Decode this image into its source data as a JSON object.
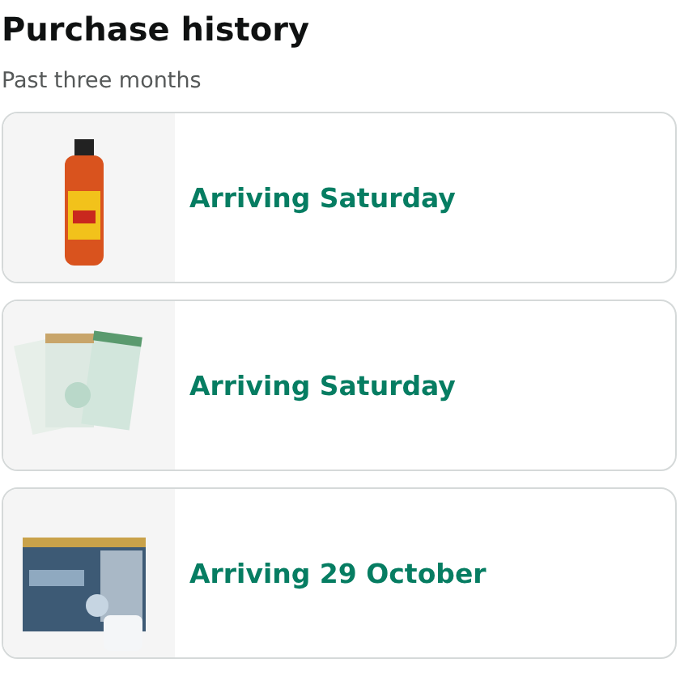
{
  "header": {
    "title": "Purchase history",
    "subtitle": "Past three months"
  },
  "orders": [
    {
      "status": "Arriving Saturday"
    },
    {
      "status": "Arriving Saturday"
    },
    {
      "status": "Arriving 29 October"
    }
  ]
}
